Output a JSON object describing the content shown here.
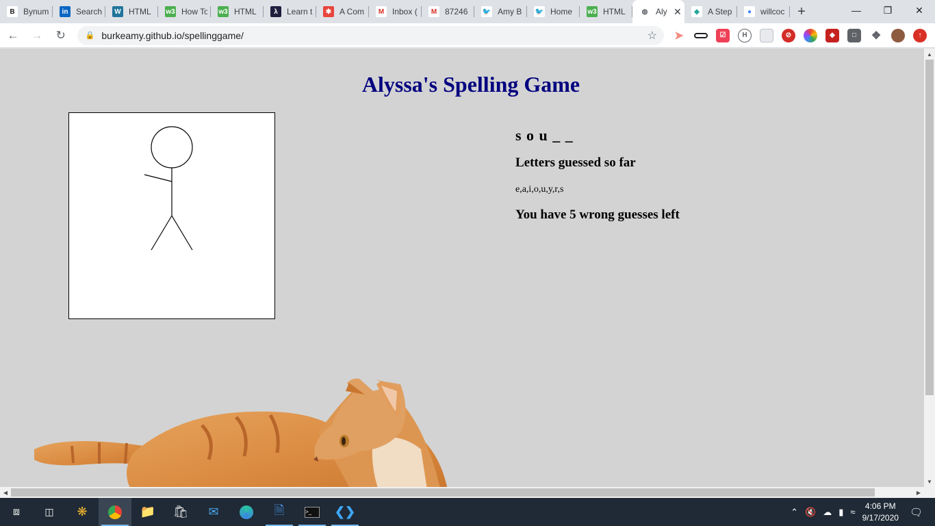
{
  "browser": {
    "tabs": [
      {
        "title": "Bynum",
        "icon": "b-icon",
        "glyph": "B",
        "color": "#ffffff",
        "text": "#202124"
      },
      {
        "title": "Search",
        "icon": "linkedin-icon",
        "glyph": "in",
        "color": "#0a66c2",
        "text": "#ffffff"
      },
      {
        "title": "HTML",
        "icon": "wordpress-icon",
        "glyph": "W",
        "color": "#21759b",
        "text": "#ffffff"
      },
      {
        "title": "How To",
        "icon": "w3schools-icon",
        "glyph": "w3",
        "color": "#4caf50",
        "text": "#ffffff"
      },
      {
        "title": "HTML",
        "icon": "w3schools-icon",
        "glyph": "w3",
        "color": "#4caf50",
        "text": "#ffffff"
      },
      {
        "title": "Learn t",
        "icon": "codecademy-icon",
        "glyph": "λ",
        "color": "#1f1f3d",
        "text": "#ffffff"
      },
      {
        "title": "A Com",
        "icon": "asterisk-icon",
        "glyph": "✱",
        "color": "#e8453c",
        "text": "#ffffff"
      },
      {
        "title": "Inbox (",
        "icon": "gmail-icon",
        "glyph": "M",
        "color": "#ffffff",
        "text": "#d93025"
      },
      {
        "title": "87246",
        "icon": "gmail-icon",
        "glyph": "M",
        "color": "#ffffff",
        "text": "#d93025"
      },
      {
        "title": "Amy B",
        "icon": "twitter-icon",
        "glyph": "🐦",
        "color": "#ffffff",
        "text": "#1da1f2"
      },
      {
        "title": "Home",
        "icon": "twitter-icon",
        "glyph": "🐦",
        "color": "#ffffff",
        "text": "#1da1f2"
      },
      {
        "title": "HTML",
        "icon": "w3schools-icon",
        "glyph": "w3",
        "color": "#4caf50",
        "text": "#ffffff"
      },
      {
        "title": "Aly",
        "icon": "globe-icon",
        "glyph": "◍",
        "color": "#ffffff",
        "text": "#5f6368",
        "active": true
      },
      {
        "title": "A Step",
        "icon": "diamond-icon",
        "glyph": "◆",
        "color": "#ffffff",
        "text": "#26a69a"
      },
      {
        "title": "willcoc",
        "icon": "circle-icon",
        "glyph": "●",
        "color": "#ffffff",
        "text": "#4285f4"
      }
    ],
    "new_tab": "+",
    "url": "burkeamy.github.io/spellinggame/"
  },
  "page": {
    "title": "Alyssa's Spelling Game",
    "word": "s o u _ _",
    "guessed_label": "Letters guessed so far",
    "guessed_letters": "e,a,i,o,u,y,r,s",
    "guesses_left": "You have 5 wrong guesses left"
  },
  "taskbar": {
    "time": "4:06 PM",
    "date": "9/17/2020"
  }
}
